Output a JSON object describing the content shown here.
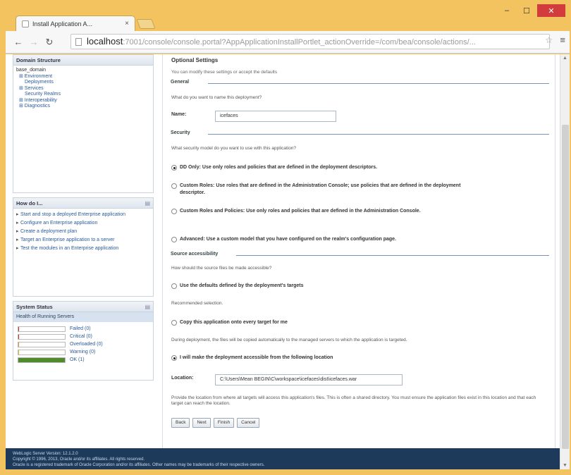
{
  "browser": {
    "tab_title": "Install Application A...",
    "tab_close": "×",
    "url_host": "localhost",
    "url_rest": ":7001/console/console.portal?AppApplicationInstallPortlet_actionOverride=/com/bea/console/actions/...",
    "window_controls": {
      "minimize": "–",
      "maximize": "☐",
      "close": "✕"
    },
    "icons": {
      "back": "left-arrow-icon",
      "forward": "right-arrow-icon",
      "reload": "reload-icon",
      "star": "bookmark-star-icon",
      "menu": "hamburger-menu-icon"
    }
  },
  "left": {
    "domain_structure": {
      "title": "Domain Structure",
      "items": [
        {
          "label": "base_domain",
          "level": 0
        },
        {
          "label": "⊞ Environment",
          "level": 1
        },
        {
          "label": "Deployments",
          "level": 2
        },
        {
          "label": "⊞ Services",
          "level": 1
        },
        {
          "label": "Security Realms",
          "level": 1
        },
        {
          "label": "⊞ Interoperability",
          "level": 1
        },
        {
          "label": "⊞ Diagnostics",
          "level": 1
        }
      ]
    },
    "how_do_i": {
      "title": "How do I...",
      "items": [
        "Start and stop a deployed Enterprise application",
        "Configure an Enterprise application",
        "Create a deployment plan",
        "Target an Enterprise application to a server",
        "Test the modules in an Enterprise application"
      ]
    },
    "system_status": {
      "title": "System Status",
      "health_title": "Health of Running Servers",
      "rows": [
        {
          "label": "Failed (0)",
          "fraction": 0.0,
          "color": "#cc3333"
        },
        {
          "label": "Critical (0)",
          "fraction": 0.0,
          "color": "#cc3333"
        },
        {
          "label": "Overloaded (0)",
          "fraction": 0.0,
          "color": "#e0a030"
        },
        {
          "label": "Warning (0)",
          "fraction": 0.0,
          "color": "#e0c030"
        },
        {
          "label": "OK (1)",
          "fraction": 1.0,
          "color": "#4f8a2c"
        }
      ]
    }
  },
  "main": {
    "title": "Optional Settings",
    "subtitle": "You can modify these settings or accept the defaults",
    "general": {
      "heading": "General",
      "question": "What do you want to name this deployment?",
      "name_label": "Name:",
      "name_value": "icefaces"
    },
    "security": {
      "heading": "Security",
      "question": "What security model do you want to use with this application?",
      "options": [
        {
          "text": "DD Only: Use only roles and policies that are defined in the deployment descriptors.",
          "checked": true
        },
        {
          "text": "Custom Roles: Use roles that are defined in the Administration Console; use policies that are defined in the deployment descriptor.",
          "checked": false
        },
        {
          "text": "Custom Roles and Policies: Use only roles and policies that are defined in the Administration Console.",
          "checked": false
        },
        {
          "text": "Advanced: Use a custom model that you have configured on the realm's configuration page.",
          "checked": false
        }
      ]
    },
    "source": {
      "heading": "Source accessibility",
      "question": "How should the source files be made accessible?",
      "opt_defaults": "Use the defaults defined by the deployment's targets",
      "recommended": "Recommended selection.",
      "opt_copy": "Copy this application onto every target for me",
      "copy_note": "During deployment, the files will be copied automatically to the managed servers to which the application is targeted.",
      "opt_manual": "I will make the deployment accessible from the following location",
      "location_label": "Location:",
      "location_value": "C:\\Users\\Mean BEGIN\\C\\workspace\\icefaces\\dist\\icefaces.war",
      "provide_note": "Provide the location from where all targets will access this application's files. This is often a shared directory. You must ensure the application files exist in this location and that each target can reach the location."
    },
    "buttons": {
      "back": "Back",
      "next": "Next",
      "finish": "Finish",
      "cancel": "Cancel"
    }
  },
  "footer": {
    "line1": "WebLogic Server Version: 12.1.2.0",
    "line2": "Copyright © 1996, 2013, Oracle and/or its affiliates. All rights reserved.",
    "line3": "Oracle is a registered trademark of Oracle Corporation and/or its affiliates. Other names may be trademarks of their respective owners."
  }
}
